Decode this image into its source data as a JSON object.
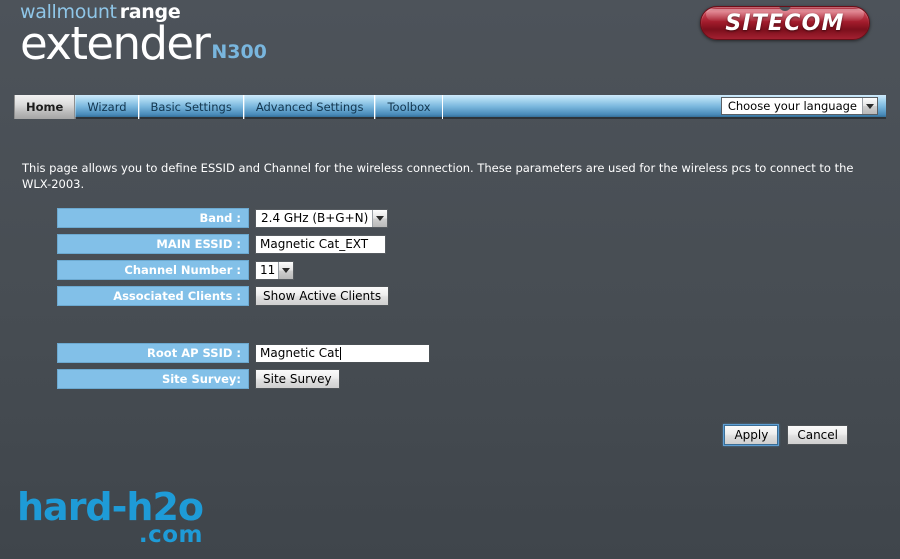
{
  "header": {
    "brand_line1_light": "wallmount",
    "brand_line1_bold": "range",
    "brand_line2": "extender",
    "brand_model": "N300",
    "logo_text": "SITECOM",
    "logo_color": "#9e2030",
    "accent_color": "#79b6de",
    "background_color": "#494f55"
  },
  "nav": {
    "tabs": [
      {
        "label": "Home",
        "active": true
      },
      {
        "label": "Wizard",
        "active": false
      },
      {
        "label": "Basic Settings",
        "active": false
      },
      {
        "label": "Advanced Settings",
        "active": false
      },
      {
        "label": "Toolbox",
        "active": false
      }
    ],
    "language_select": {
      "value": "Choose your language",
      "icon": "chevron-down-icon"
    }
  },
  "page": {
    "description": "This page allows you to define ESSID and Channel for the wireless connection. These parameters are used for the wireless pcs to connect to the WLX-2003."
  },
  "form": {
    "label_cell_color": "#82c0e8",
    "rows": [
      {
        "label": "Band :",
        "type": "select",
        "value": "2.4 GHz (B+G+N)"
      },
      {
        "label": "MAIN ESSID :",
        "type": "text",
        "value": "Magnetic Cat_EXT"
      },
      {
        "label": "Channel Number :",
        "type": "select",
        "value": "11"
      },
      {
        "label": "Associated Clients :",
        "type": "button",
        "value": "Show Active Clients"
      },
      {
        "label": "Root AP SSID :",
        "type": "text",
        "value": "Magnetic Cat"
      },
      {
        "label": "Site Survey:",
        "type": "button",
        "value": "Site Survey"
      }
    ]
  },
  "actions": {
    "apply_label": "Apply",
    "cancel_label": "Cancel"
  },
  "watermark": {
    "main": "hard-h2o",
    "sub": ".com",
    "color": "#1e9bd7"
  }
}
